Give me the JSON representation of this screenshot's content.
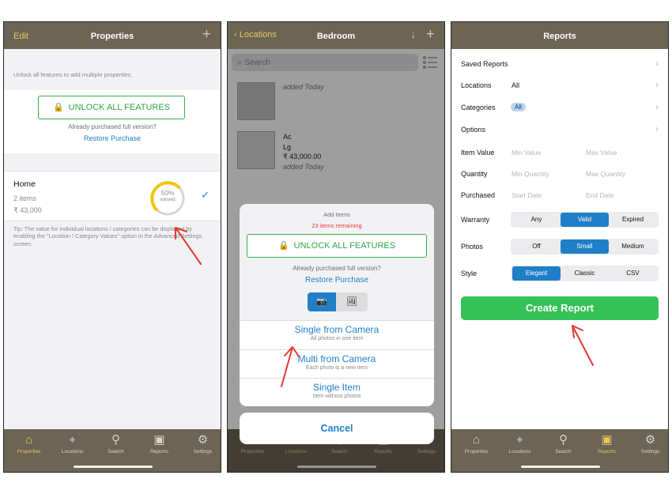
{
  "phone1": {
    "nav": {
      "left": "Edit",
      "title": "Properties",
      "right": "+"
    },
    "note": "Unlock all features to add multiple properties.",
    "unlock": {
      "label": "UNLOCK ALL FEATURES",
      "purchased": "Already purchased full version?",
      "restore": "Restore Purchase"
    },
    "home": {
      "name": "Home",
      "items": "2 items",
      "value": "₹ 43,000",
      "gauge_pct": "50%",
      "gauge_label": "valued",
      "gauge_fraction": 0.5
    },
    "tip": "Tip: The value for individual locations / categories can be displayed by enabling the \"Location / Category Values\" option in the Advanced Settings screen."
  },
  "phone2": {
    "nav": {
      "back": "Locations",
      "title": "Bedroom",
      "down": "↓",
      "right": "+"
    },
    "search_placeholder": "Search",
    "items": [
      {
        "line1": "",
        "line2": "",
        "line3": "",
        "added": "added Today"
      },
      {
        "line1": "Ac",
        "line2": "Lg",
        "line3": "₹ 43,000.00",
        "added": "added Today"
      }
    ],
    "sheet": {
      "title": "Add Items",
      "remaining": "23 items remaining",
      "unlock": "UNLOCK ALL FEATURES",
      "purchased": "Already purchased full version?",
      "restore": "Restore Purchase",
      "options": [
        {
          "title": "Single from Camera",
          "sub": "All photos in one item"
        },
        {
          "title": "Multi from Camera",
          "sub": "Each photo is a new item"
        },
        {
          "title": "Single Item",
          "sub": "Item without photos"
        }
      ],
      "cancel": "Cancel"
    }
  },
  "phone3": {
    "nav": {
      "title": "Reports"
    },
    "rows": {
      "saved": "Saved Reports",
      "locations": "Locations",
      "locations_val": "All",
      "categories": "Categories",
      "categories_val": "All",
      "options": "Options",
      "item_value": "Item Value",
      "min_value": "Min Value",
      "max_value": "Max Value",
      "quantity": "Quantity",
      "min_qty": "Min Quantity",
      "max_qty": "Max Quantity",
      "purchased": "Purchased",
      "start_date": "Start Date",
      "end_date": "End Date",
      "warranty": "Warranty",
      "warranty_opts": [
        "Any",
        "Valid",
        "Expired"
      ],
      "photos": "Photos",
      "photos_opts": [
        "Off",
        "Small",
        "Medium"
      ],
      "style": "Style",
      "style_opts": [
        "Elegant",
        "Classic",
        "CSV"
      ]
    },
    "create": "Create Report"
  },
  "tabs": [
    "Properties",
    "Locations",
    "Search",
    "Reports",
    "Settings"
  ],
  "colors": {
    "bar": "#6c6455",
    "accent": "#e9c75a",
    "blue": "#1f7fc9",
    "green": "#34c257",
    "arrow": "#e53935"
  }
}
